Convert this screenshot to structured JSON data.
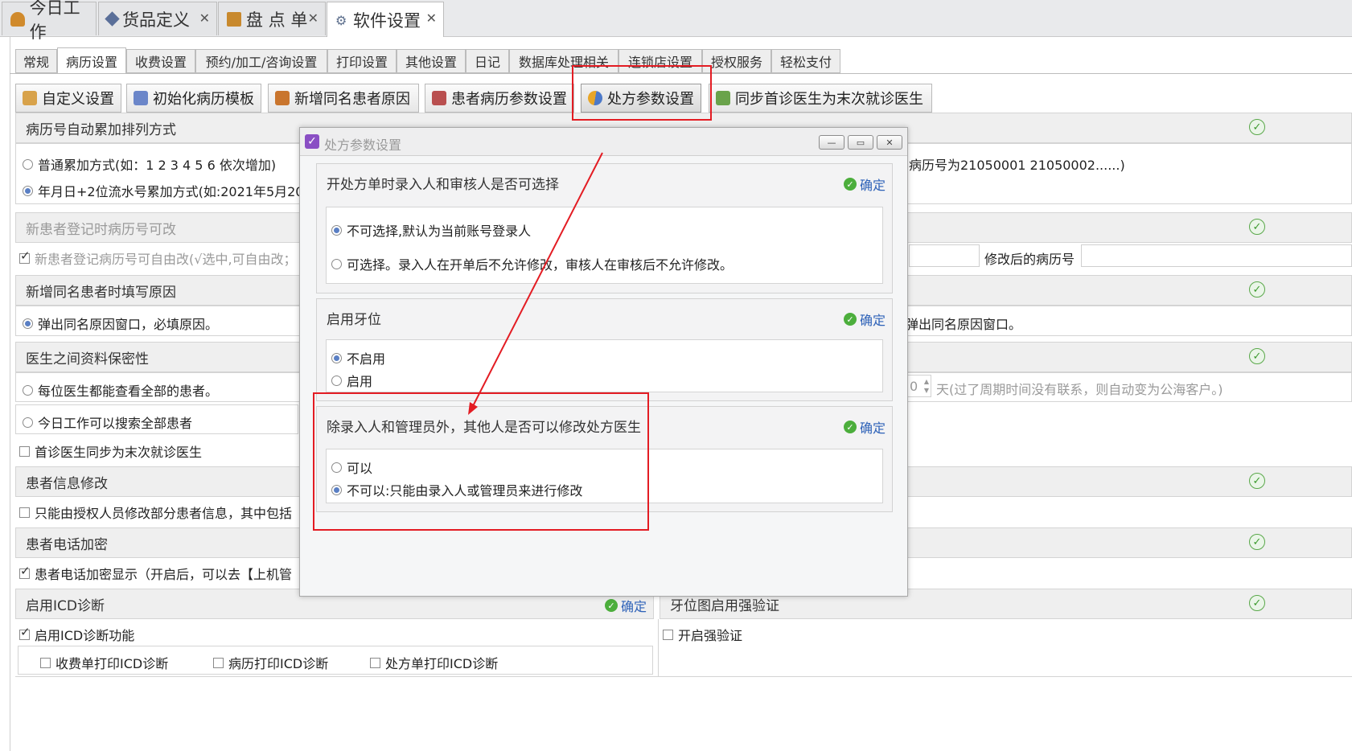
{
  "doc_tabs": [
    {
      "label": "今日工作",
      "closable": false
    },
    {
      "label": "货品定义",
      "closable": true
    },
    {
      "label": "盘 点 单",
      "closable": true
    },
    {
      "label": "软件设置",
      "closable": true,
      "active": true
    }
  ],
  "settings_tabs": [
    "常规",
    "病历设置",
    "收费设置",
    "预约/加工/咨询设置",
    "打印设置",
    "其他设置",
    "日记",
    "数据库处理相关",
    "连锁店设置",
    "授权服务",
    "轻松支付"
  ],
  "toolbar": [
    "自定义设置",
    "初始化病历模板",
    "新增同名患者原因",
    "患者病历参数设置",
    "处方参数设置",
    "同步首诊医生为末次就诊医生"
  ],
  "groups": {
    "auto_increment": {
      "title": "病历号自动累加排列方式",
      "opt1": "普通累加方式(如：1 2 3 4 5 6 依次增加)",
      "opt2": "年月日+2位流水号累加方式(如:2021年5月20",
      "opt2_tail": "病历号为21050001 21050002......)"
    },
    "new_patient_edit": {
      "title": "新患者登记时病历号可改",
      "check": "新患者登记病历号可自由改(√选中,可自由改；",
      "modified_label": "修改后的病历号"
    },
    "same_name": {
      "title": "新增同名患者时填写原因",
      "opt1": "弹出同名原因窗口，必填原因。",
      "opt2_tail": "弹出同名原因窗口。"
    },
    "privacy": {
      "title": "医生之间资料保密性",
      "opt1": "每位医生都能查看全部的患者。",
      "opt2": "今日工作可以搜索全部患者",
      "check": "首诊医生同步为末次就诊医生",
      "days_value": "0",
      "days_tail": "天(过了周期时间没有联系，则自动变为公海客户。)"
    },
    "patient_edit": {
      "title": "患者信息修改",
      "check": "只能由授权人员修改部分患者信息，其中包括"
    },
    "phone_encrypt": {
      "title": "患者电话加密",
      "check": "患者电话加密显示（开启后，可以去【上机管"
    },
    "icd": {
      "title": "启用ICD诊断",
      "confirm": "确定",
      "check": "启用ICD诊断功能",
      "sub1": "收费单打印ICD诊断",
      "sub2": "病历打印ICD诊断",
      "sub3": "处方单打印ICD诊断"
    },
    "tooth_chart": {
      "title": "牙位图启用强验证",
      "check": "开启强验证"
    }
  },
  "dialog": {
    "title": "处方参数设置",
    "sections": [
      {
        "title": "开处方单时录入人和审核人是否可选择",
        "confirm": "确定",
        "options": [
          "不可选择,默认为当前账号登录人",
          "可选择。录入人在开单后不允许修改，审核人在审核后不允许修改。"
        ],
        "selected": 0
      },
      {
        "title": "启用牙位",
        "confirm": "确定",
        "options": [
          "不启用",
          "启用"
        ],
        "selected": 0
      },
      {
        "title": "除录入人和管理员外，其他人是否可以修改处方医生",
        "confirm": "确定",
        "options": [
          "可以",
          "不可以:只能由录入人或管理员来进行修改"
        ],
        "selected": 1
      }
    ]
  },
  "colors": {
    "annotation": "#e31c23",
    "confirm_text": "#2e62b8",
    "ok_green": "#4cae3c"
  }
}
